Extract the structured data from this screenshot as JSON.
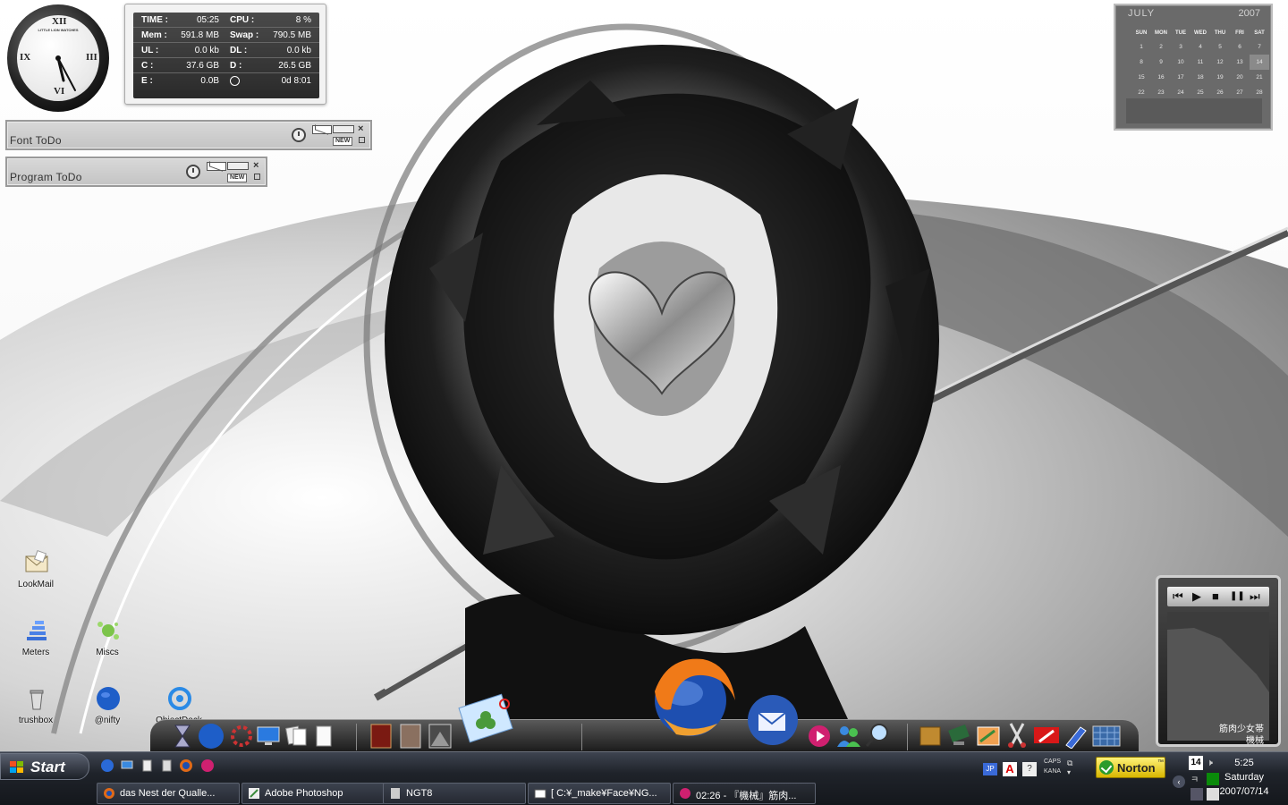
{
  "colors": {
    "taskbar": "#1f232a",
    "wallpaper_light": "#f0f0f0",
    "wallpaper_dark": "#111111",
    "norton": "#f5e042"
  },
  "clock_widget": {
    "brand": "LITTLE LION WATCHES",
    "numerals": [
      "XII",
      "III",
      "VI",
      "IX"
    ]
  },
  "system_monitor": {
    "rows": [
      {
        "k1": "TIME :",
        "v1": "05:25",
        "k2": "CPU :",
        "v2": "8 %"
      },
      {
        "k1": "Mem :",
        "v1": "591.8 MB",
        "k2": "Swap :",
        "v2": "790.5 MB"
      },
      {
        "k1": "UL :",
        "v1": "0.0 kb",
        "k2": "DL :",
        "v2": "0.0 kb"
      },
      {
        "k1": "C :",
        "v1": "37.6 GB",
        "k2": "D :",
        "v2": "26.5 GB"
      },
      {
        "k1": "E :",
        "v1": "0.0B",
        "k2": "",
        "v2": "0d 8:01"
      }
    ]
  },
  "todos": [
    {
      "label": "Font  ToDo",
      "new_label": "NEW"
    },
    {
      "label": "Program ToDo",
      "new_label": "NEW"
    }
  ],
  "calendar": {
    "month": "JULY",
    "year": "2007",
    "weekdays": [
      "SUN",
      "MON",
      "TUE",
      "WED",
      "THU",
      "FRI",
      "SAT"
    ],
    "weeks": [
      [
        "1",
        "2",
        "3",
        "4",
        "5",
        "6",
        "7"
      ],
      [
        "8",
        "9",
        "10",
        "11",
        "12",
        "13",
        "14"
      ],
      [
        "15",
        "16",
        "17",
        "18",
        "19",
        "20",
        "21"
      ],
      [
        "22",
        "23",
        "24",
        "25",
        "26",
        "27",
        "28"
      ],
      [
        "29",
        "30",
        "31",
        "",
        "",
        "",
        ""
      ]
    ],
    "today": "14"
  },
  "desktop_icons": [
    {
      "label": "LookMail",
      "icon": "mail-icon"
    },
    {
      "label": "Meters",
      "icon": "meters-icon"
    },
    {
      "label": "Miscs",
      "icon": "atom-icon"
    },
    {
      "label": "trushbox",
      "icon": "trash-icon"
    },
    {
      "label": "@nifty",
      "icon": "globe-icon"
    },
    {
      "label": "ObjectDock",
      "icon": "dock-icon"
    }
  ],
  "media_player": {
    "controls": [
      "⏮",
      "▶",
      "■",
      "❚❚",
      "⏭"
    ],
    "line1": "筋肉少女帯",
    "line2": "機械"
  },
  "taskbar": {
    "start_label": "Start",
    "tasks": [
      {
        "title": "das Nest der Qualle...",
        "icon": "firefox-icon"
      },
      {
        "title": "Adobe Photoshop",
        "icon": "photoshop-icon"
      },
      {
        "title": "NGT8",
        "icon": "document-icon"
      },
      {
        "title": "[ C:¥_make¥Face¥NG...",
        "icon": "folder-icon"
      },
      {
        "title": "02:26 - 『機械』筋肉...",
        "icon": "music-icon"
      }
    ],
    "tray": {
      "lang": "JP",
      "caps": "CAPS",
      "kana": "KANA",
      "norton": "Norton",
      "trademark": "™",
      "date_badge": "14",
      "time": "5:25",
      "day": "Saturday",
      "date": "2007/07/14"
    }
  }
}
